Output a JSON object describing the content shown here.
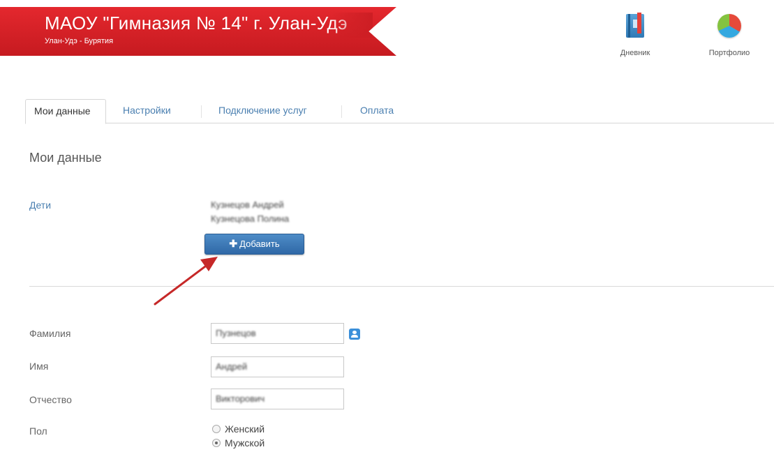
{
  "header": {
    "title": "МАОУ \"Гимназия № 14\" г. Улан-Удэ",
    "subtitle": "Улан-Удэ - Бурятия",
    "brand_color": "#d42026"
  },
  "nav": {
    "diary": {
      "label": "Дневник",
      "icon": "diary-icon"
    },
    "portfolio": {
      "label": "Портфолио",
      "icon": "pie-chart-icon"
    }
  },
  "tabs": [
    {
      "label": "Мои данные",
      "active": true
    },
    {
      "label": "Настройки",
      "active": false
    },
    {
      "label": "Подключение услуг",
      "active": false
    },
    {
      "label": "Оплата",
      "active": false
    }
  ],
  "section_title": "Мои данные",
  "children": {
    "label": "Дети",
    "items": [
      "Кузнецов Андрей",
      "Кузнецова Полина"
    ],
    "add_button": "Добавить"
  },
  "form": {
    "surname": {
      "label": "Фамилия",
      "value": "Пузнецов"
    },
    "name": {
      "label": "Имя",
      "value": "Андрей"
    },
    "patronymic": {
      "label": "Отчество",
      "value": "Викторович"
    },
    "gender": {
      "label": "Пол",
      "options": [
        "Женский",
        "Мужской"
      ],
      "selected": "Мужской"
    }
  },
  "colors": {
    "link": "#4a7fb0",
    "button": "#3a76b4",
    "annotation_arrow": "#c62828"
  }
}
